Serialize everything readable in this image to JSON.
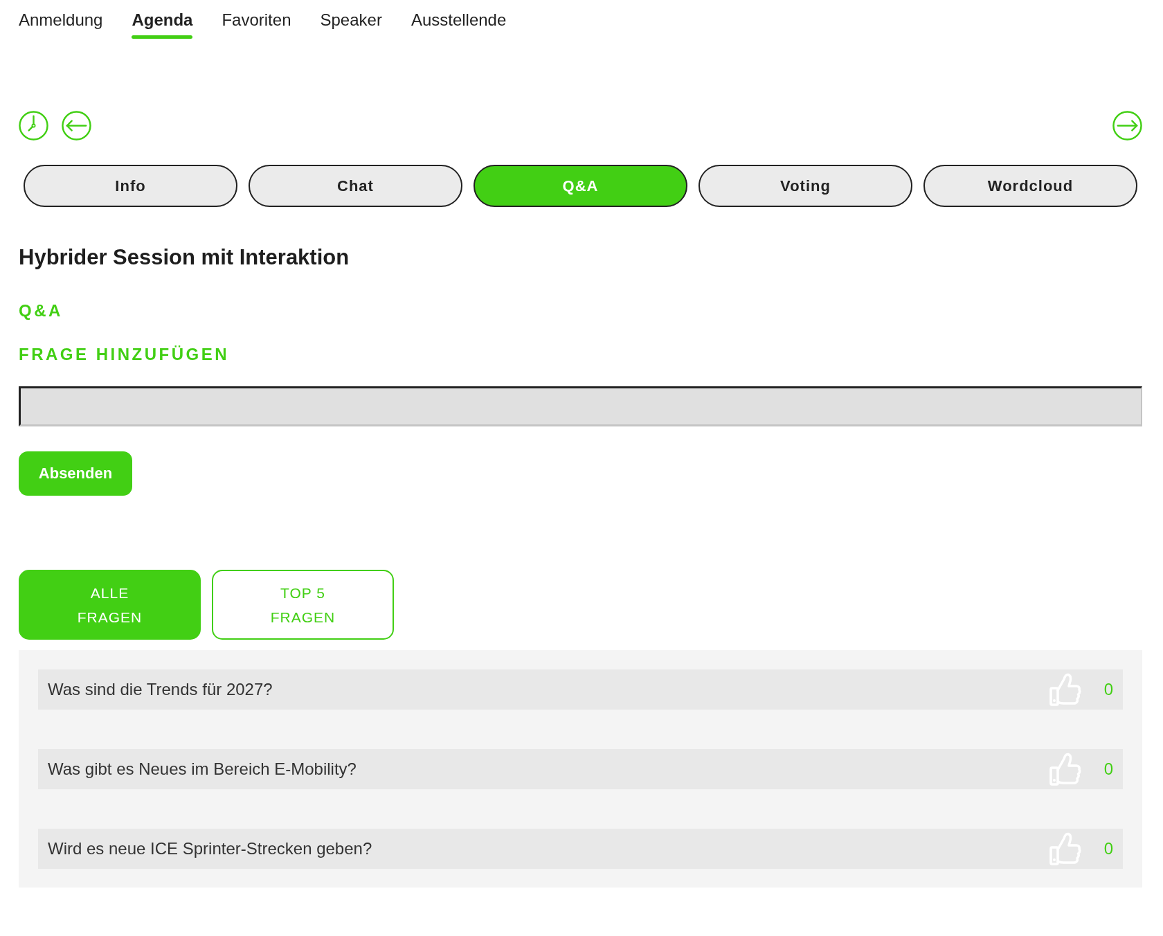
{
  "top_nav": [
    {
      "label": "Anmeldung",
      "selected": false
    },
    {
      "label": "Agenda",
      "selected": true
    },
    {
      "label": "Favoriten",
      "selected": false
    },
    {
      "label": "Speaker",
      "selected": false
    },
    {
      "label": "Ausstellende",
      "selected": false
    }
  ],
  "session_tabs": [
    {
      "label": "Info",
      "selected": false
    },
    {
      "label": "Chat",
      "selected": false
    },
    {
      "label": "Q&A",
      "selected": true
    },
    {
      "label": "Voting",
      "selected": false
    },
    {
      "label": "Wordcloud",
      "selected": false
    }
  ],
  "session_title": "Hybrider Session mit Interaktion",
  "section_label": "Q&A",
  "question_form": {
    "heading": "FRAGE HINZUFÜGEN",
    "submit_button": "Absenden"
  },
  "filters": [
    {
      "label": "ALLE FRAGEN",
      "selected": true
    },
    {
      "label": "TOP 5 FRAGEN",
      "selected": false
    }
  ],
  "questions": [
    {
      "text": "Was sind die Trends für 2027?",
      "votes": "0"
    },
    {
      "text": "Was gibt es Neues im Bereich E-Mobility?",
      "votes": "0"
    },
    {
      "text": "Wird es neue ICE Sprinter-Strecken geben?",
      "votes": "0"
    }
  ]
}
